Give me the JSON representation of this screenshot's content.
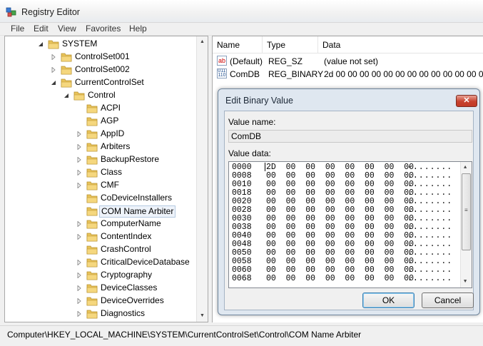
{
  "window": {
    "title": "Registry Editor"
  },
  "menu": [
    "File",
    "Edit",
    "View",
    "Favorites",
    "Help"
  ],
  "tree": [
    {
      "label": "SYSTEM",
      "expanded": true
    },
    {
      "label": "ControlSet001",
      "expanded": false
    },
    {
      "label": "ControlSet002",
      "expanded": false
    },
    {
      "label": "CurrentControlSet",
      "expanded": true
    },
    {
      "label": "Control",
      "expanded": true
    },
    {
      "label": "ACPI",
      "expanded": null
    },
    {
      "label": "AGP",
      "expanded": null
    },
    {
      "label": "AppID",
      "expanded": false
    },
    {
      "label": "Arbiters",
      "expanded": false
    },
    {
      "label": "BackupRestore",
      "expanded": false
    },
    {
      "label": "Class",
      "expanded": false
    },
    {
      "label": "CMF",
      "expanded": false
    },
    {
      "label": "CoDeviceInstallers",
      "expanded": null
    },
    {
      "label": "COM Name Arbiter",
      "expanded": null,
      "selected": true
    },
    {
      "label": "ComputerName",
      "expanded": false
    },
    {
      "label": "ContentIndex",
      "expanded": false
    },
    {
      "label": "CrashControl",
      "expanded": null
    },
    {
      "label": "CriticalDeviceDatabase",
      "expanded": false
    },
    {
      "label": "Cryptography",
      "expanded": false
    },
    {
      "label": "DeviceClasses",
      "expanded": false
    },
    {
      "label": "DeviceOverrides",
      "expanded": false
    },
    {
      "label": "Diagnostics",
      "expanded": false
    }
  ],
  "list": {
    "columns": [
      "Name",
      "Type",
      "Data"
    ],
    "rows": [
      {
        "icon": "string-value-icon",
        "name": "(Default)",
        "type": "REG_SZ",
        "data": "(value not set)"
      },
      {
        "icon": "binary-value-icon",
        "name": "ComDB",
        "type": "REG_BINARY",
        "data": "2d 00 00 00 00 00 00 00 00 00 00 00 00 00"
      }
    ]
  },
  "dialog": {
    "title": "Edit Binary Value",
    "close_label": "✕",
    "value_name_label": "Value name:",
    "value_name": "ComDB",
    "value_data_label": "Value data:",
    "hex_rows": [
      {
        "offset": "0000",
        "bytes": "2D  00  00  00  00  00  00  00",
        "ascii": "-......."
      },
      {
        "offset": "0008",
        "bytes": "00  00  00  00  00  00  00  00",
        "ascii": "........"
      },
      {
        "offset": "0010",
        "bytes": "00  00  00  00  00  00  00  00",
        "ascii": "........"
      },
      {
        "offset": "0018",
        "bytes": "00  00  00  00  00  00  00  00",
        "ascii": "........"
      },
      {
        "offset": "0020",
        "bytes": "00  00  00  00  00  00  00  00",
        "ascii": "........"
      },
      {
        "offset": "0028",
        "bytes": "00  00  00  00  00  00  00  00",
        "ascii": "........"
      },
      {
        "offset": "0030",
        "bytes": "00  00  00  00  00  00  00  00",
        "ascii": "........"
      },
      {
        "offset": "0038",
        "bytes": "00  00  00  00  00  00  00  00",
        "ascii": "........"
      },
      {
        "offset": "0040",
        "bytes": "00  00  00  00  00  00  00  00",
        "ascii": "........"
      },
      {
        "offset": "0048",
        "bytes": "00  00  00  00  00  00  00  00",
        "ascii": "........"
      },
      {
        "offset": "0050",
        "bytes": "00  00  00  00  00  00  00  00",
        "ascii": "........"
      },
      {
        "offset": "0058",
        "bytes": "00  00  00  00  00  00  00  00",
        "ascii": "........"
      },
      {
        "offset": "0060",
        "bytes": "00  00  00  00  00  00  00  00",
        "ascii": "........"
      },
      {
        "offset": "0068",
        "bytes": "00  00  00  00  00  00  00  00",
        "ascii": "........"
      }
    ],
    "ok_label": "OK",
    "cancel_label": "Cancel"
  },
  "status": {
    "path": "Computer\\HKEY_LOCAL_MACHINE\\SYSTEM\\CurrentControlSet\\Control\\COM Name Arbiter"
  },
  "colors": {
    "folder": "#e8c35a",
    "dialog_frame": "#dfe7f0",
    "close_red": "#c7412e"
  }
}
